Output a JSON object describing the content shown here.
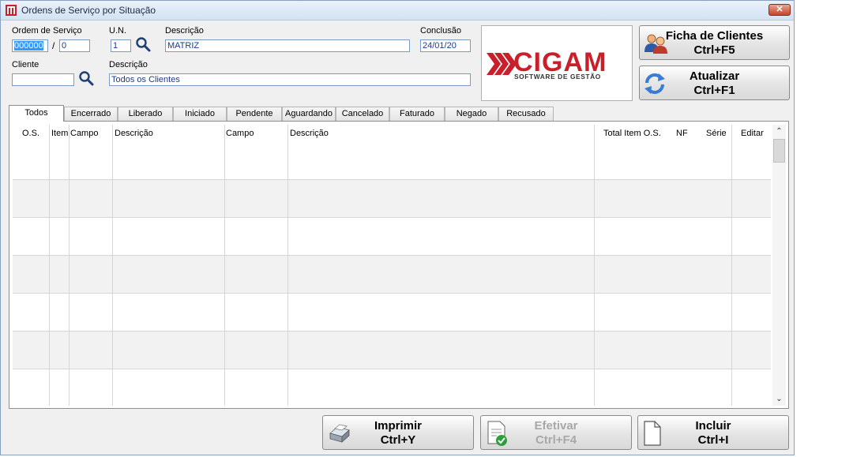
{
  "window": {
    "title": "Ordens de Serviço por Situação",
    "close_label": "✕"
  },
  "form": {
    "ordem_label": "Ordem de Serviço",
    "ordem_value": "000000",
    "ordem_sep": "/",
    "ordem_seq": "0",
    "un_label": "U.N.",
    "un_value": "1",
    "descricao1_label": "Descrição",
    "descricao1_value": "MATRIZ",
    "conclusao_label": "Conclusão",
    "conclusao_value": "24/01/20",
    "cliente_label": "Cliente",
    "cliente_value": "",
    "descricao2_label": "Descrição",
    "descricao2_value": "Todos os Clientes"
  },
  "logo": {
    "brand": "CIGAM",
    "tagline": "SOFTWARE DE GESTÃO",
    "color": "#c8202a"
  },
  "buttons": {
    "ficha": {
      "line1": "Ficha de Clientes",
      "line2": "Ctrl+F5",
      "icon": "users-icon"
    },
    "atualizar": {
      "line1": "Atualizar",
      "line2": "Ctrl+F1",
      "icon": "refresh-icon"
    },
    "imprimir": {
      "line1": "Imprimir",
      "line2": "Ctrl+Y",
      "icon": "printer-icon"
    },
    "efetivar": {
      "line1": "Efetivar",
      "line2": "Ctrl+F4",
      "icon": "document-check-icon",
      "disabled": true
    },
    "incluir": {
      "line1": "Incluir",
      "line2": "Ctrl+I",
      "icon": "document-icon"
    }
  },
  "tabs": [
    "Todos",
    "Encerrado",
    "Liberado",
    "Iniciado",
    "Pendente",
    "Aguardando",
    "Cancelado",
    "Faturado",
    "Negado",
    "Recusado"
  ],
  "active_tab": "Todos",
  "grid": {
    "columns": [
      "O.S.",
      "Item",
      "Campo",
      "Descrição",
      "Campo",
      "Descrição",
      "Total Item O.S.",
      "NF",
      "Série",
      "Editar"
    ],
    "rows": []
  },
  "scrollbar": {
    "up": "⌃",
    "down": "⌄"
  }
}
